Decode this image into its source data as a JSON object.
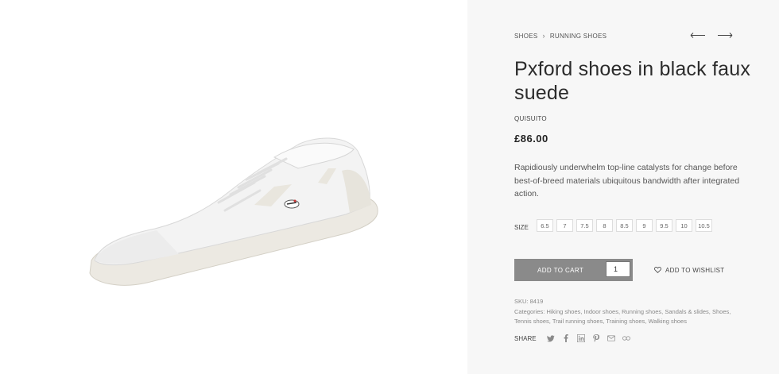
{
  "breadcrumb": {
    "item1": "Shoes",
    "separator": "›",
    "item2": "Running shoes"
  },
  "nav": {
    "prev_icon": "arrow-left-icon",
    "next_icon": "arrow-right-icon"
  },
  "product": {
    "title": "Pxford shoes in black faux suede",
    "brand": "Quisuito",
    "price": "£86.00",
    "description": "Rapidiously underwhelm top-line catalysts for change before best-of-breed materials ubiquitous bandwidth after integrated action."
  },
  "size": {
    "label": "Size",
    "options": [
      "6.5",
      "7",
      "7.5",
      "8",
      "8.5",
      "9",
      "9.5",
      "10",
      "10.5"
    ]
  },
  "cart": {
    "button_label": "Add to cart",
    "quantity": "1"
  },
  "wishlist": {
    "label": "Add to wishlist",
    "icon": "heart-icon"
  },
  "meta": {
    "sku_label": "SKU:",
    "sku": "8419",
    "categories_label": "Categories:",
    "categories": [
      "Hiking shoes",
      "Indoor shoes",
      "Running shoes",
      "Sandals & slides",
      "Shoes",
      "Tennis shoes",
      "Trail running shoes",
      "Training shoes",
      "Walking shoes"
    ]
  },
  "share": {
    "label": "Share",
    "icons": [
      "twitter-icon",
      "facebook-icon",
      "linkedin-icon",
      "pinterest-icon",
      "email-icon",
      "link-icon"
    ]
  },
  "colors": {
    "panel_bg": "#f7f7f7",
    "button_bg": "#8a8a8a"
  }
}
